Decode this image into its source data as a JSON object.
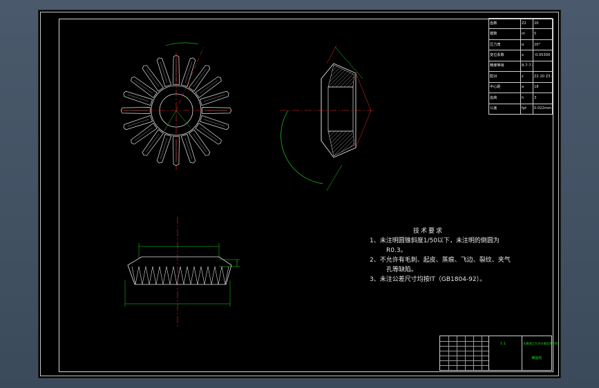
{
  "params": {
    "rows": [
      [
        "齿数",
        "Z2",
        "20"
      ],
      [
        "模数",
        "m",
        "5"
      ],
      [
        "压力角",
        "α",
        "20°"
      ],
      [
        "变位系数",
        "x",
        "-0.05300"
      ],
      [
        "精度等级",
        "8-7-7-8GB10095-88",
        ""
      ],
      [
        "配对",
        "z",
        "Z2 20 Z3 42"
      ],
      [
        "中心距",
        "a",
        "18"
      ],
      [
        "齿高",
        "h",
        "3"
      ],
      [
        "公差",
        "fpt",
        "0.022mm"
      ]
    ]
  },
  "technical_requirements": {
    "title": "技术要求",
    "items": [
      "1、未注明圆锥斜度1/50以下，未注明的倒圆为",
      "R0.3。",
      "2、不允许有毛刺、起皮、蒸痕、飞边、裂纹、夹气",
      "孔等缺陷。",
      "3、未注公差尺寸均按IT（GB1804-92）。"
    ]
  },
  "title_block": {
    "scale": "1:1",
    "drawing_name": "锥齿轮",
    "school": "长春理工大学光电信息学院",
    "labels": [
      "标记",
      "处数",
      "分区",
      "更改文件号",
      "签名",
      "日期"
    ]
  },
  "colors": {
    "line_white": "#e6e6e6",
    "center_red": "#ff2a2a",
    "dimension_green": "#22dd22",
    "paper": "#000000"
  }
}
